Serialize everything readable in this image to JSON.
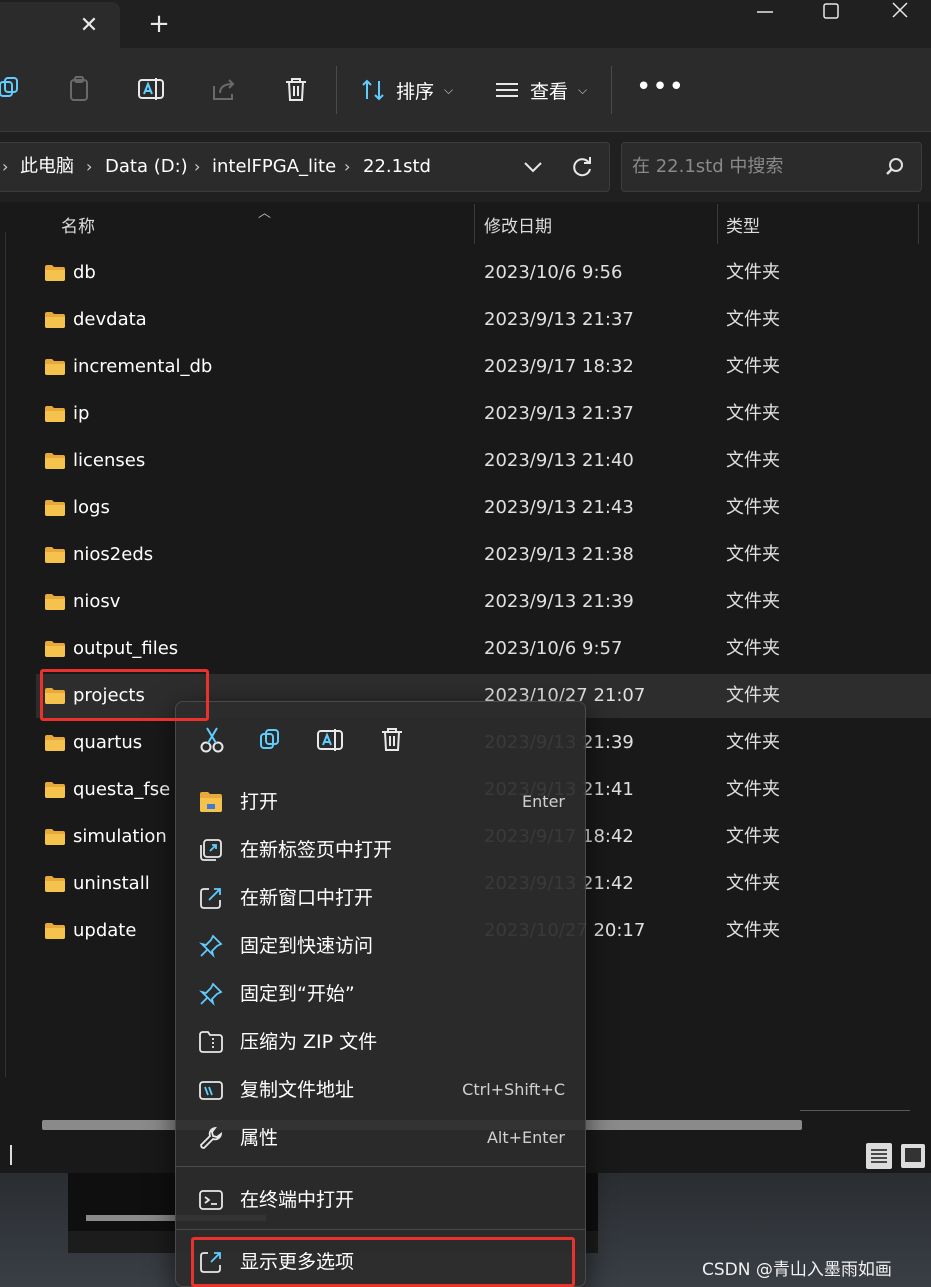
{
  "titlebar": {
    "close_tab_glyph": "✕",
    "new_tab_glyph": "+"
  },
  "toolbar": {
    "sort_label": "排序",
    "view_label": "查看",
    "more_glyph": "•••"
  },
  "address": {
    "crumbs": [
      "此电脑",
      "Data (D:)",
      "intelFPGA_lite",
      "22.1std"
    ],
    "search_placeholder": "在 22.1std 中搜索"
  },
  "columns": {
    "name": "名称",
    "modified": "修改日期",
    "type": "类型"
  },
  "files": [
    {
      "name": "db",
      "date": "2023/10/6 9:56",
      "type": "文件夹"
    },
    {
      "name": "devdata",
      "date": "2023/9/13 21:37",
      "type": "文件夹"
    },
    {
      "name": "incremental_db",
      "date": "2023/9/17 18:32",
      "type": "文件夹"
    },
    {
      "name": "ip",
      "date": "2023/9/13 21:37",
      "type": "文件夹"
    },
    {
      "name": "licenses",
      "date": "2023/9/13 21:40",
      "type": "文件夹"
    },
    {
      "name": "logs",
      "date": "2023/9/13 21:43",
      "type": "文件夹"
    },
    {
      "name": "nios2eds",
      "date": "2023/9/13 21:38",
      "type": "文件夹"
    },
    {
      "name": "niosv",
      "date": "2023/9/13 21:39",
      "type": "文件夹"
    },
    {
      "name": "output_files",
      "date": "2023/10/6 9:57",
      "type": "文件夹"
    },
    {
      "name": "projects",
      "date": "2023/10/27 21:07",
      "type": "文件夹"
    },
    {
      "name": "quartus",
      "date": "2023/9/13 21:39",
      "type": "文件夹"
    },
    {
      "name": "questa_fse",
      "date": "2023/9/13 21:41",
      "type": "文件夹"
    },
    {
      "name": "simulation",
      "date": "2023/9/17 18:42",
      "type": "文件夹"
    },
    {
      "name": "uninstall",
      "date": "2023/9/13 21:42",
      "type": "文件夹"
    },
    {
      "name": "update",
      "date": "2023/10/27 20:17",
      "type": "文件夹"
    }
  ],
  "context_menu": {
    "items": [
      {
        "label": "打开",
        "shortcut": "Enter",
        "icon": "folder-open-icon"
      },
      {
        "label": "在新标签页中打开",
        "shortcut": "",
        "icon": "new-tab-icon"
      },
      {
        "label": "在新窗口中打开",
        "shortcut": "",
        "icon": "new-window-icon"
      },
      {
        "label": "固定到快速访问",
        "shortcut": "",
        "icon": "pin-icon"
      },
      {
        "label": "固定到“开始”",
        "shortcut": "",
        "icon": "pin-start-icon"
      },
      {
        "label": "压缩为 ZIP 文件",
        "shortcut": "",
        "icon": "zip-icon"
      },
      {
        "label": "复制文件地址",
        "shortcut": "Ctrl+Shift+C",
        "icon": "copy-path-icon"
      },
      {
        "label": "属性",
        "shortcut": "Alt+Enter",
        "icon": "wrench-icon"
      },
      {
        "label": "在终端中打开",
        "shortcut": "",
        "icon": "terminal-icon"
      },
      {
        "label": "显示更多选项",
        "shortcut": "",
        "icon": "more-options-icon"
      }
    ]
  },
  "watermark": "CSDN @青山入墨雨如画",
  "colors": {
    "accent": "#60cdff",
    "folder": "#f4c24d",
    "annotation": "#e8322b"
  }
}
